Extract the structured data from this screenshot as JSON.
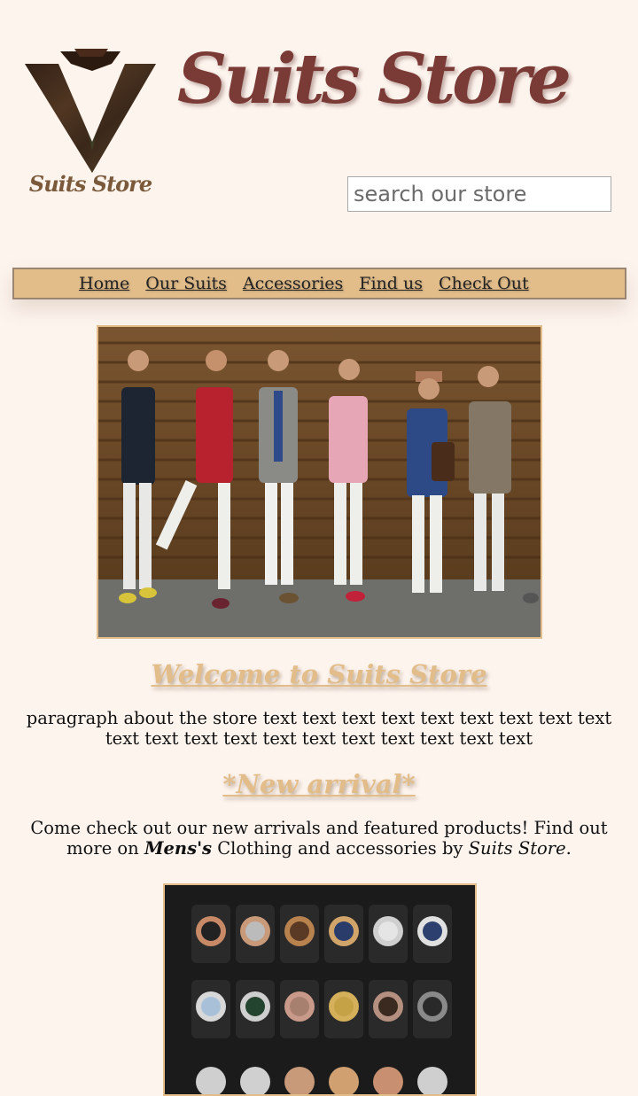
{
  "brand": {
    "title": "Suits Store",
    "logo_text": "Suits Store"
  },
  "search": {
    "placeholder": "search our store"
  },
  "nav": {
    "items": [
      "Home",
      "Our Suits",
      "Accessories",
      "Find us",
      "Check Out"
    ]
  },
  "welcome": {
    "heading": "Welcome to Suits Store",
    "paragraph": "paragraph about the store text text text text text text text text text text text text text text text text text text text text"
  },
  "new_arrival": {
    "heading": "*New arrival*",
    "text_before": "Come check out our new arrivals and featured products! Find out more on ",
    "bold_italic": "Mens's",
    "text_middle": " Clothing and accessories by ",
    "italic": "Suits Store",
    "text_end": "."
  },
  "colors": {
    "background": "#fdf4ee",
    "accent": "#e2bd8a",
    "brand": "#7a3a35"
  }
}
